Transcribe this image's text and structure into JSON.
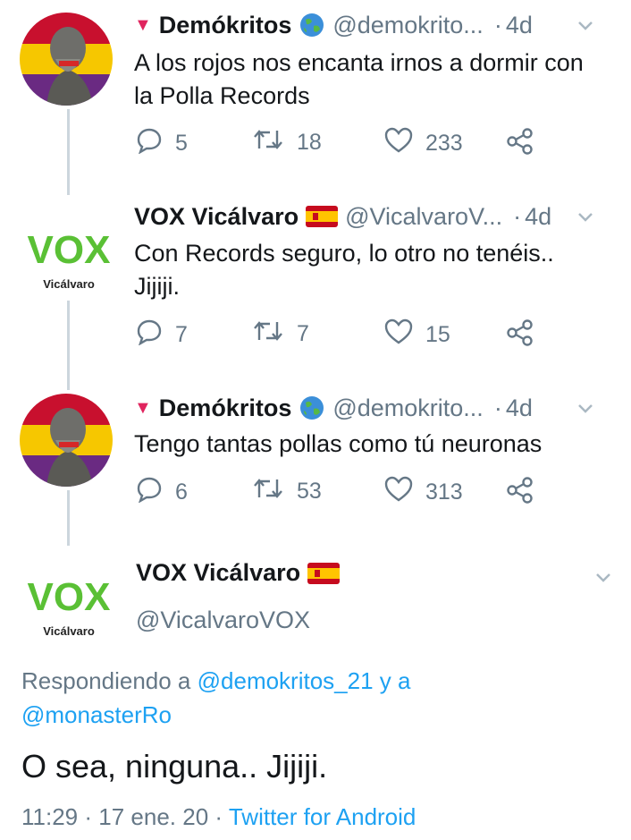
{
  "thread": [
    {
      "author": "Demókritos",
      "handle": "@demokrito...",
      "separator": "·",
      "time": "4d",
      "text": "A los rojos nos encanta irnos a dormir con la Polla Records",
      "replies": "5",
      "retweets": "18",
      "likes": "233"
    },
    {
      "author": "VOX Vicálvaro",
      "handle": "@VicalvaroV...",
      "separator": "·",
      "time": "4d",
      "text": "Con Records seguro, lo otro no tenéis.. Jijiji.",
      "replies": "7",
      "retweets": "7",
      "likes": "15"
    },
    {
      "author": "Demókritos",
      "handle": "@demokrito...",
      "separator": "·",
      "time": "4d",
      "text": "Tengo tantas pollas como tú neuronas",
      "replies": "6",
      "retweets": "53",
      "likes": "313"
    }
  ],
  "main_tweet": {
    "author": "VOX Vicálvaro",
    "handle": "@VicalvaroVOX",
    "replying_prefix": "Respondiendo a",
    "reply_user_1": "@demokritos_21",
    "reply_joiner": "y a",
    "reply_user_2": "@monasterRo",
    "text": "O sea, ninguna.. Jijiji.",
    "time": "11:29",
    "date": "17 ene. 20",
    "separator": "·",
    "source": "Twitter for Android"
  },
  "vox_logo": {
    "wordmark": "VOX",
    "sub": "Vicálvaro"
  },
  "colors": {
    "accent": "#1da1f2",
    "muted": "#657786",
    "vox_green": "#5ac035",
    "triangle_red": "#e0245e"
  },
  "icons": [
    "down-triangle-icon",
    "globe-emoji-icon",
    "spain-flag-icon",
    "reply-icon",
    "retweet-icon",
    "like-icon",
    "share-icon",
    "chevron-down-icon"
  ]
}
